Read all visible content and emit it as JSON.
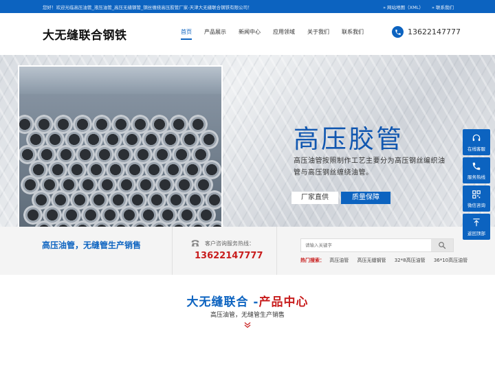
{
  "topbar": {
    "welcome": "您好！欢迎光临高压油管_液压油管_高压无缝钢管_钢丝缠绕高压胶管厂家-天津大无缝联合钢铁有限公司！",
    "sitemap": "» 网站地图（XML）",
    "contact": "» 联系我们"
  },
  "header": {
    "logo": "大无缝联合钢铁",
    "nav": [
      {
        "label": "首页"
      },
      {
        "label": "产品展示"
      },
      {
        "label": "新闻中心"
      },
      {
        "label": "应用领域"
      },
      {
        "label": "关于我们"
      },
      {
        "label": "联系我们"
      }
    ],
    "phone": "13622147777"
  },
  "banner": {
    "title": "高压胶管",
    "desc": "高压油管按照制作工艺主要分为高压钢丝编织油管与高压钢丝缠绕油管。",
    "tag1": "厂家直供",
    "tag2": "质量保障"
  },
  "band": {
    "slogan": "高压油管，无缝管生产销售",
    "hotline_label": "客户咨询服务热线：",
    "hotline": "13622147777",
    "search_placeholder": "请输入关键字",
    "hot_label": "热门搜索：",
    "hot_keywords": [
      "高压油管",
      "高压无缝钢管",
      "32*8高压油管",
      "36*10高压油管"
    ]
  },
  "products": {
    "title_blue": "大无缝联合 -",
    "title_red": "产品中心",
    "subtitle": "高压油管，无缝管生产销售"
  },
  "float": {
    "items": [
      {
        "label": "在线客服",
        "icon": "headset-icon"
      },
      {
        "label": "服务热线",
        "icon": "phone-icon"
      },
      {
        "label": "微信咨询",
        "icon": "qrcode-icon"
      },
      {
        "label": "返回顶部",
        "icon": "arrow-up-icon"
      }
    ]
  },
  "colors": {
    "primary": "#0c63c0",
    "accent_red": "#c81d1d"
  }
}
